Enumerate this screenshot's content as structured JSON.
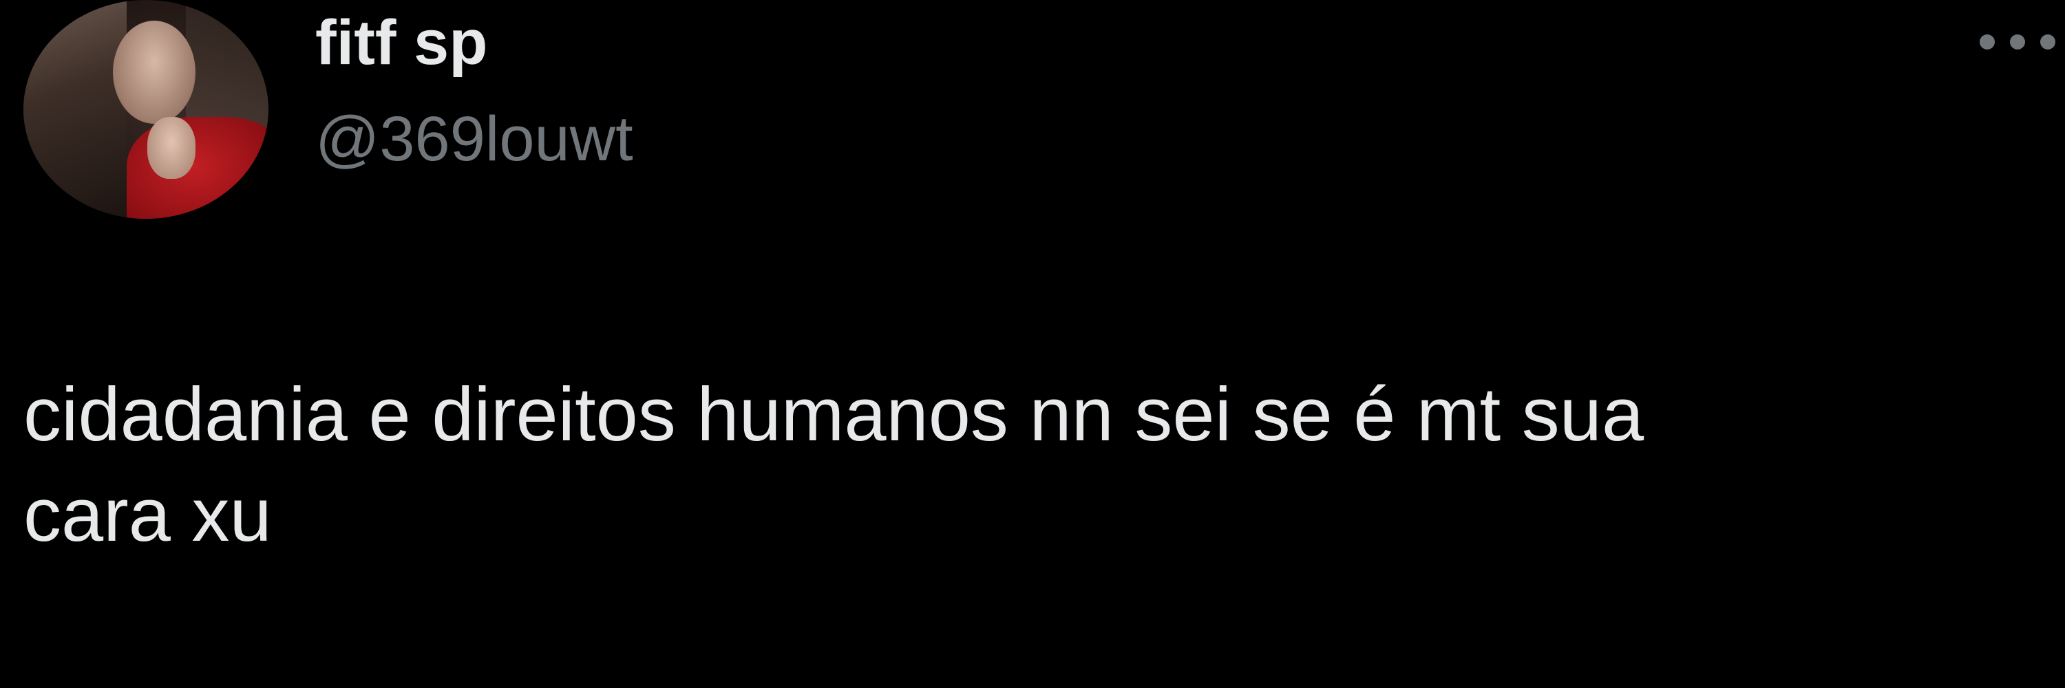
{
  "tweet": {
    "author": {
      "display_name": "fitf sp",
      "handle": "@369louwt",
      "avatar_icon": "profile-photo"
    },
    "more_icon": "more-horizontal-icon",
    "text_lines": [
      "cidadania e direitos humanos nn sei se é mt sua",
      "cara xu"
    ]
  },
  "colors": {
    "background": "#000000",
    "primary_text": "#e7e9ea",
    "secondary_text": "#71767b"
  }
}
